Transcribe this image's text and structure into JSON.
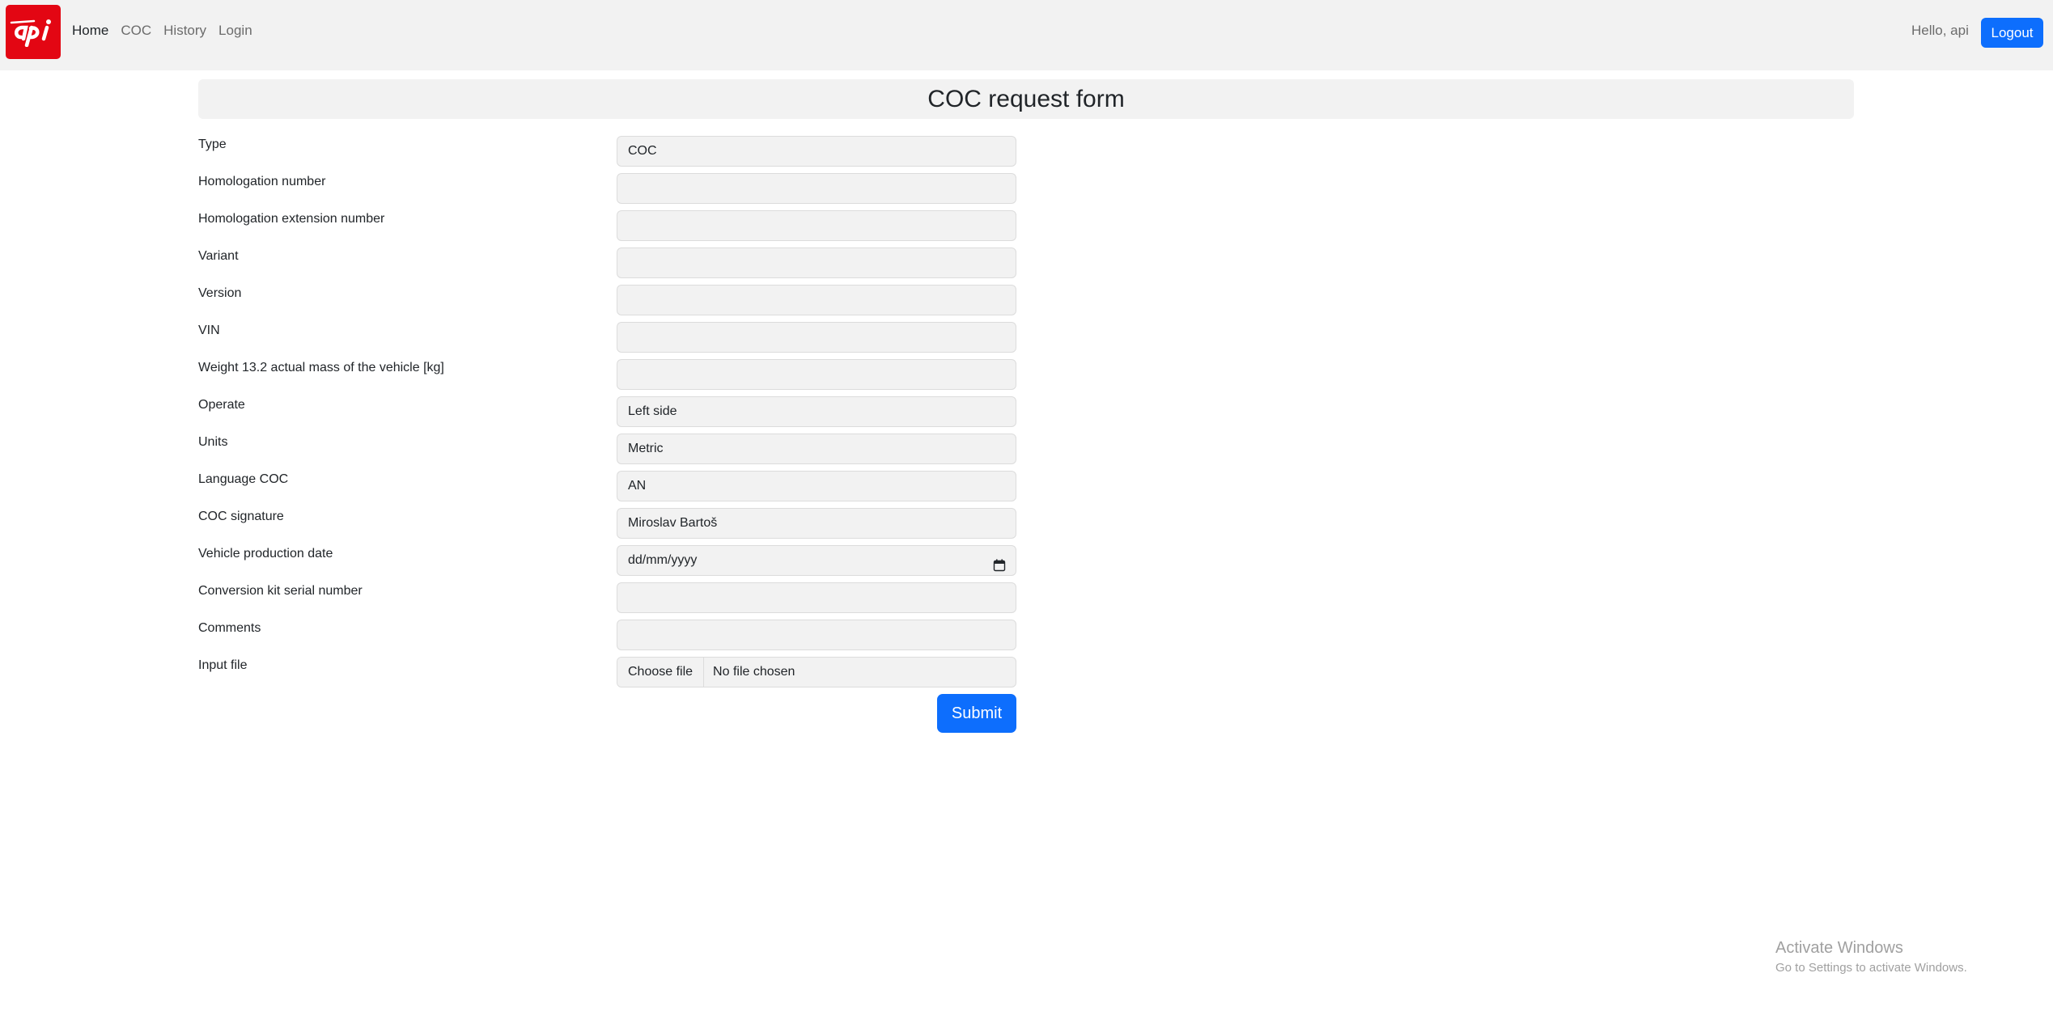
{
  "nav": {
    "logo_text": "api",
    "links": [
      "Home",
      "COC",
      "History",
      "Login"
    ],
    "active": "Home",
    "greeting": "Hello, api",
    "logout_label": "Logout"
  },
  "form": {
    "title": "COC request form",
    "fields": [
      {
        "label": "Type",
        "value": "COC"
      },
      {
        "label": "Homologation number",
        "value": ""
      },
      {
        "label": "Homologation extension number",
        "value": ""
      },
      {
        "label": "Variant",
        "value": ""
      },
      {
        "label": "Version",
        "value": ""
      },
      {
        "label": "VIN",
        "value": ""
      },
      {
        "label": "Weight 13.2 actual mass of the vehicle [kg]",
        "value": ""
      },
      {
        "label": "Operate",
        "value": "Left side"
      },
      {
        "label": "Units",
        "value": "Metric"
      },
      {
        "label": "Language COC",
        "value": "AN"
      },
      {
        "label": "COC signature",
        "value": "Miroslav Bartoš"
      },
      {
        "label": "Vehicle production date",
        "value": "dd/mm/yyyy"
      },
      {
        "label": "Conversion kit serial number",
        "value": ""
      },
      {
        "label": "Comments",
        "value": ""
      },
      {
        "label": "Input file",
        "button": "Choose file",
        "status": "No file chosen"
      }
    ],
    "submit_label": "Submit"
  },
  "watermark": {
    "title": "Activate Windows",
    "subtitle": "Go to Settings to activate Windows."
  },
  "colors": {
    "brand": "#e30613",
    "primary": "#0d6efd",
    "navbar_bg": "#f2f2f2"
  },
  "icons": {
    "logo": "api-logo-icon",
    "date": "calendar-icon"
  }
}
